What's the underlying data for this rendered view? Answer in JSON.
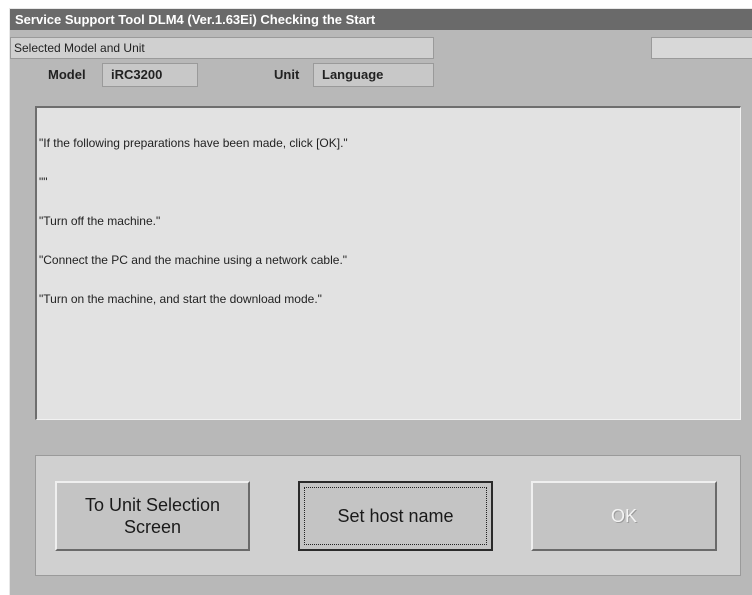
{
  "window": {
    "title": "Service Support Tool DLM4 (Ver.1.63Ei) Checking the Start"
  },
  "info": {
    "section_label": "Selected Model and Unit",
    "model_label": "Model",
    "model_value": "iRC3200",
    "unit_label": "Unit",
    "unit_value": "Language"
  },
  "message": {
    "lines": [
      "\"If the following preparations have been made, click [OK].\"",
      "\"\"",
      "\"Turn off the machine.\"",
      "\"Connect the PC and the machine using a network cable.\"",
      "\"Turn on the machine, and start the download mode.\""
    ]
  },
  "buttons": {
    "unit_selection_line1": "To Unit Selection",
    "unit_selection_line2": "Screen",
    "set_host_name": "Set host name",
    "ok": "OK",
    "ok_enabled": false
  }
}
